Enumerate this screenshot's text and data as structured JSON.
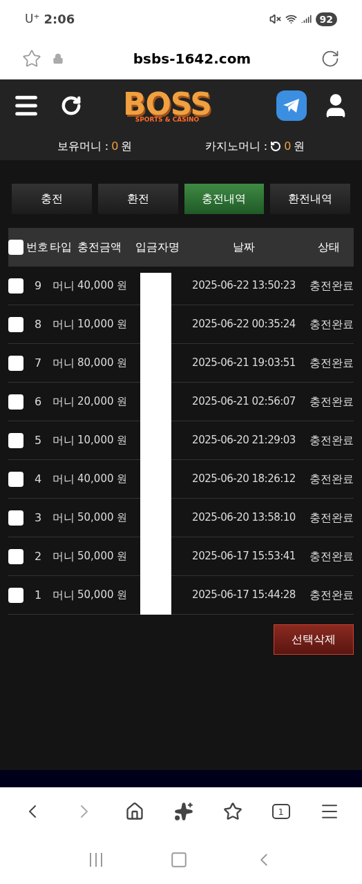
{
  "status_bar": {
    "carrier": "U⁺",
    "time": "2:06",
    "battery": "92"
  },
  "browser": {
    "url": "bsbs-1642.com",
    "tab_count": "1"
  },
  "site_header": {
    "logo": {
      "title": "BOSS",
      "subtitle": "SPORTS & CASINO"
    },
    "balances": [
      {
        "label": "보유머니 :",
        "value": "0",
        "unit": "원",
        "kind": "plain"
      },
      {
        "label": "카지노머니 :",
        "value": "0",
        "unit": "원",
        "kind": "refresh"
      }
    ]
  },
  "tabs": [
    {
      "label": "충전",
      "selected": false
    },
    {
      "label": "환전",
      "selected": false
    },
    {
      "label": "충전내역",
      "selected": true
    },
    {
      "label": "환전내역",
      "selected": false
    }
  ],
  "table": {
    "select_all_checked": false,
    "columns": [
      "번호",
      "타입",
      "충전금액",
      "입금자명",
      "날짜",
      "상태"
    ],
    "rows": [
      {
        "checked": false,
        "number": "9",
        "type": "머니",
        "amount": "40,000 원",
        "date": "2025-06-22 13:50:23",
        "status": "충전완료"
      },
      {
        "checked": false,
        "number": "8",
        "type": "머니",
        "amount": "10,000 원",
        "date": "2025-06-22 00:35:24",
        "status": "충전완료"
      },
      {
        "checked": false,
        "number": "7",
        "type": "머니",
        "amount": "80,000 원",
        "date": "2025-06-21 19:03:51",
        "status": "충전완료"
      },
      {
        "checked": false,
        "number": "6",
        "type": "머니",
        "amount": "20,000 원",
        "date": "2025-06-21 02:56:07",
        "status": "충전완료"
      },
      {
        "checked": false,
        "number": "5",
        "type": "머니",
        "amount": "10,000 원",
        "date": "2025-06-20 21:29:03",
        "status": "충전완료"
      },
      {
        "checked": false,
        "number": "4",
        "type": "머니",
        "amount": "40,000 원",
        "date": "2025-06-20 18:26:12",
        "status": "충전완료"
      },
      {
        "checked": false,
        "number": "3",
        "type": "머니",
        "amount": "50,000 원",
        "date": "2025-06-20 13:58:10",
        "status": "충전완료"
      },
      {
        "checked": false,
        "number": "2",
        "type": "머니",
        "amount": "50,000 원",
        "date": "2025-06-17 15:53:41",
        "status": "충전완료"
      },
      {
        "checked": false,
        "number": "1",
        "type": "머니",
        "amount": "50,000 원",
        "date": "2025-06-17 15:44:28",
        "status": "충전완료"
      }
    ]
  },
  "delete_button": "선택삭제"
}
